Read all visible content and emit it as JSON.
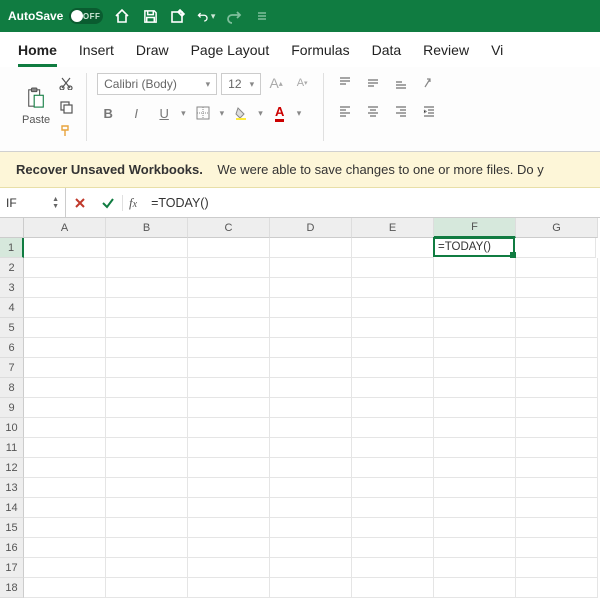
{
  "titlebar": {
    "autosave_label": "AutoSave",
    "autosave_state": "OFF"
  },
  "tabs": [
    "Home",
    "Insert",
    "Draw",
    "Page Layout",
    "Formulas",
    "Data",
    "Review",
    "Vi"
  ],
  "active_tab": "Home",
  "ribbon": {
    "paste_label": "Paste",
    "font_name": "Calibri (Body)",
    "font_size": "12",
    "increase_font": "A",
    "decrease_font": "A",
    "bold": "B",
    "italic": "I",
    "underline": "U"
  },
  "banner": {
    "title": "Recover Unsaved Workbooks.",
    "message": "We were able to save changes to one or more files. Do y"
  },
  "formula_bar": {
    "name_box": "IF",
    "formula": "=TODAY()"
  },
  "grid": {
    "columns": [
      "A",
      "B",
      "C",
      "D",
      "E",
      "F",
      "G"
    ],
    "active_col": "F",
    "rows": 18,
    "active_row": 1,
    "active_cell_value": "=TODAY()"
  }
}
